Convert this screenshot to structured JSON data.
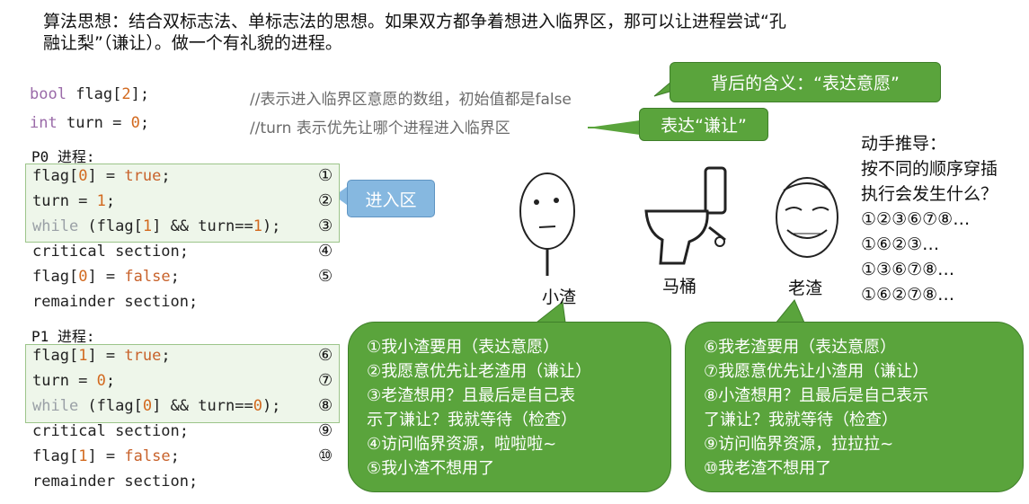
{
  "intro": {
    "line1": "算法思想：结合双标志法、单标志法的思想。如果双方都争着想进入临界区，那可以让进程尝试“孔",
    "line2": "融让梨”（谦让）。做一个有礼貌的进程。"
  },
  "decl": {
    "bool_kw": "bool",
    "bool_rest": " flag[",
    "bool_num": "2",
    "bool_end": "];",
    "bool_comment": "//表示进入临界区意愿的数组，初始值都是false",
    "int_kw": "int",
    "int_rest": " turn = ",
    "int_num": "0",
    "int_end": ";",
    "int_comment": "//turn 表示优先让哪个进程进入临界区"
  },
  "callouts": {
    "meaning": "背后的含义：“表达意愿”",
    "humble": "表达“谦让”",
    "entry": "进入区"
  },
  "p0": {
    "label": "P0 进程:",
    "lines": [
      {
        "a": "flag[",
        "n": "0",
        "b": "] = ",
        "lit": "true",
        "c": ";",
        "mark": "①"
      },
      {
        "a": "turn = ",
        "n": "1",
        "b": ";",
        "lit": "",
        "c": "",
        "mark": "②"
      },
      {
        "w": "while",
        "a": " (flag[",
        "n": "1",
        "b": "] && turn==",
        "n2": "1",
        "c": ");",
        "mark": "③"
      },
      {
        "a": "critical section;",
        "mark": "④"
      },
      {
        "a": "flag[",
        "n": "0",
        "b": "] = ",
        "lit": "false",
        "c": ";",
        "mark": "⑤"
      },
      {
        "a": "remainder section;",
        "mark": ""
      }
    ]
  },
  "p1": {
    "label": "P1 进程:",
    "lines": [
      {
        "a": "flag[",
        "n": "1",
        "b": "] = ",
        "lit": "true",
        "c": ";",
        "mark": "⑥"
      },
      {
        "a": "turn = ",
        "n": "0",
        "b": ";",
        "lit": "",
        "c": "",
        "mark": "⑦"
      },
      {
        "w": "while",
        "a": " (flag[",
        "n": "0",
        "b": "] && turn==",
        "n2": "0",
        "c": ");",
        "mark": "⑧"
      },
      {
        "a": "critical section;",
        "mark": "⑨"
      },
      {
        "a": "flag[",
        "n": "1",
        "b": "] = ",
        "lit": "false",
        "c": ";",
        "mark": "⑩"
      },
      {
        "a": "remainder section;",
        "mark": ""
      }
    ]
  },
  "figures": {
    "xiaozha": "小渣",
    "toilet": "马桶",
    "laozha": "老渣"
  },
  "bubble_left": [
    "①我小渣要用（表达意愿）",
    "②我愿意优先让老渣用（谦让）",
    "③老渣想用？且最后是自己表",
    "示了谦让？我就等待（检查）",
    "④访问临界资源，啦啦啦~",
    "⑤我小渣不想用了"
  ],
  "bubble_right": [
    "⑥我老渣要用（表达意愿）",
    "⑦我愿意优先让小渣用（谦让）",
    "⑧小渣想用？且最后是自己表示",
    "了谦让？我就等待（检查）",
    "⑨访问临界资源，拉拉拉~",
    "⑩我老渣不想用了"
  ],
  "right_panel": {
    "title": "动手推导：",
    "q1": "按不同的顺序穿插",
    "q2": "执行会发生什么？",
    "seqs": [
      "①②③⑥⑦⑧…",
      "①⑥②③…",
      "①③⑥⑦⑧…",
      "①⑥②⑦⑧…"
    ]
  },
  "colors": {
    "bubble_green": "#5aa43c",
    "entry_blue": "#86b8e0",
    "keyword": "#9a6aa8",
    "number": "#d2691e"
  }
}
